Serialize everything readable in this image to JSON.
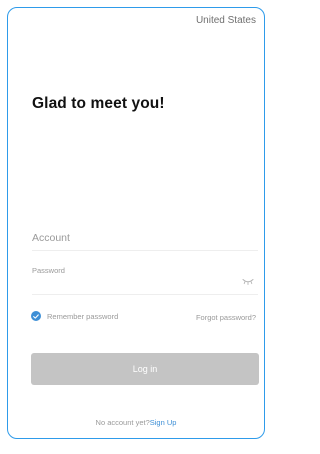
{
  "header": {
    "region": "United States"
  },
  "main": {
    "headline": "Glad to meet you!"
  },
  "form": {
    "account_placeholder": "Account",
    "account_value": "",
    "password_placeholder": "Password",
    "password_value": "",
    "password_toggle_icon": "eye-closed-icon",
    "remember_checked": true,
    "remember_label": "Remember password",
    "forgot_label": "Forgot password?",
    "login_label": "Log in"
  },
  "footer": {
    "no_account_text": "No account yet?",
    "signup_label": "Sign Up"
  },
  "colors": {
    "accent": "#3d8fd6",
    "frame": "#2e9bea",
    "button_disabled": "#c4c4c4",
    "muted_text": "#9a9a9a"
  }
}
